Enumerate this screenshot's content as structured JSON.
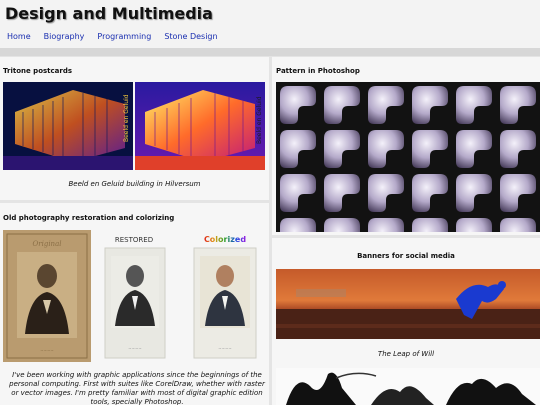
{
  "site": {
    "title": "Design and Multimedia"
  },
  "nav": {
    "items": [
      "Home",
      "Biography",
      "Programming",
      "Stone Design"
    ]
  },
  "tritone": {
    "title": "Tritone postcards",
    "caption": "Beeld en Geluid building in Hilversum",
    "side_text": "Beeld en Geluid"
  },
  "pattern": {
    "title": "Pattern in Photoshop"
  },
  "restoration": {
    "title": "Old photography restoration and colorizing",
    "label_original": "Original",
    "label_restored": "RESTORED",
    "label_colorized": "Colorized",
    "body": "I've been working with graphic applications since the beginnings of the personal computing. First with suites like CorelDraw, whether with raster or vector images. I'm pretty familiar with most of digital graphic edition tools, specially Photoshop."
  },
  "banners": {
    "title": "Banners for social media",
    "caption": "The Leap of Will"
  },
  "colors": {
    "link": "#1a2fb0",
    "panel_bg": "#f6f6f6",
    "page_bg": "#e4e4e4"
  }
}
